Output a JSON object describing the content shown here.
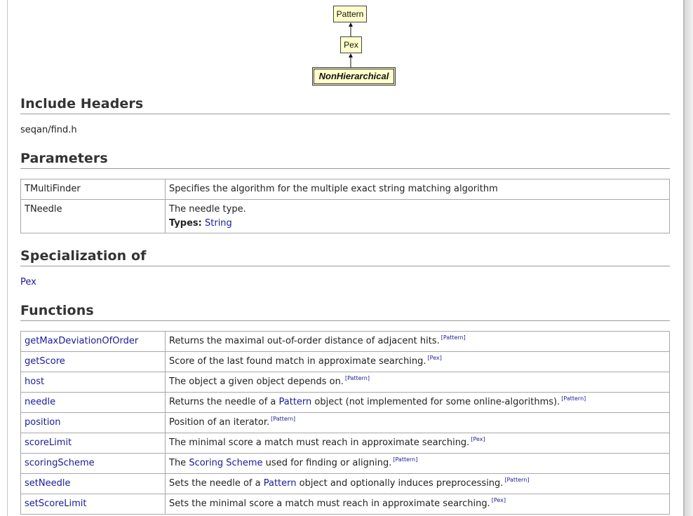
{
  "diagram": {
    "nodes": [
      "Pattern",
      "Pex",
      "NonHierarchical"
    ]
  },
  "sections": {
    "include_headers": {
      "title": "Include Headers",
      "value": "seqan/find.h"
    },
    "parameters": {
      "title": "Parameters",
      "rows": [
        {
          "name": "TMultiFinder",
          "desc": "Specifies the algorithm for the multiple exact string matching algorithm"
        },
        {
          "name": "TNeedle",
          "desc": "The needle type.",
          "types_label": "Types:",
          "types_value": "String"
        }
      ]
    },
    "specialization": {
      "title": "Specialization of",
      "value": "Pex"
    },
    "functions": {
      "title": "Functions",
      "rows": [
        {
          "name": "getMaxDeviationOfOrder",
          "pre": "Returns the maximal out-of-order distance of adjacent hits.",
          "link": "",
          "post": "",
          "tag": "[Pattern]"
        },
        {
          "name": "getScore",
          "pre": "Score of the last found match in approximate searching.",
          "link": "",
          "post": "",
          "tag": "[Pex]"
        },
        {
          "name": "host",
          "pre": "The object a given object depends on.",
          "link": "",
          "post": "",
          "tag": "[Pattern]"
        },
        {
          "name": "needle",
          "pre": "Returns the needle of a ",
          "link": "Pattern",
          "post": " object (not implemented for some online-algorithms).",
          "tag": "[Pattern]"
        },
        {
          "name": "position",
          "pre": "Position of an iterator.",
          "link": "",
          "post": "",
          "tag": "[Pattern]"
        },
        {
          "name": "scoreLimit",
          "pre": "The minimal score a match must reach in approximate searching.",
          "link": "",
          "post": "",
          "tag": "[Pex]"
        },
        {
          "name": "scoringScheme",
          "pre": "The ",
          "link": "Scoring Scheme",
          "post": " used for finding or aligning.",
          "tag": "[Pattern]"
        },
        {
          "name": "setNeedle",
          "pre": "Sets the needle of a ",
          "link": "Pattern",
          "post": " object and optionally induces preprocessing.",
          "tag": "[Pattern]"
        },
        {
          "name": "setScoreLimit",
          "pre": "Sets the minimal score a match must reach in approximate searching.",
          "link": "",
          "post": "",
          "tag": "[Pex]"
        }
      ]
    }
  },
  "colors": {
    "link": "#1a1a9a",
    "node_fill": "#ffffcc",
    "rule": "#999999",
    "grid": "#a8a8a8"
  }
}
